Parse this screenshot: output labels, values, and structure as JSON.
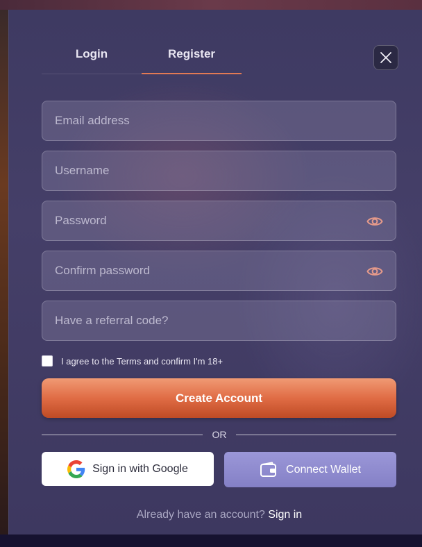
{
  "tabs": [
    {
      "label": "Login",
      "active": false
    },
    {
      "label": "Register",
      "active": true
    }
  ],
  "accent_color": "#e27a54",
  "fields": {
    "email": {
      "placeholder": "Email address",
      "value": ""
    },
    "username": {
      "placeholder": "Username",
      "value": ""
    },
    "password": {
      "placeholder": "Password",
      "value": ""
    },
    "confirm_password": {
      "placeholder": "Confirm password",
      "value": ""
    },
    "referral": {
      "placeholder": "Have a referral code?",
      "value": ""
    }
  },
  "agree_label": "I agree to the Terms and confirm I'm 18+",
  "agree_checked": false,
  "create_button": "Create Account",
  "divider_text": "OR",
  "google_button": "Sign in with Google",
  "wallet_button": "Connect Wallet",
  "footer": {
    "prompt": "Already have an account?",
    "link": "Sign in"
  },
  "icons": [
    "close-icon",
    "eye-icon",
    "google-icon",
    "wallet-icon"
  ]
}
